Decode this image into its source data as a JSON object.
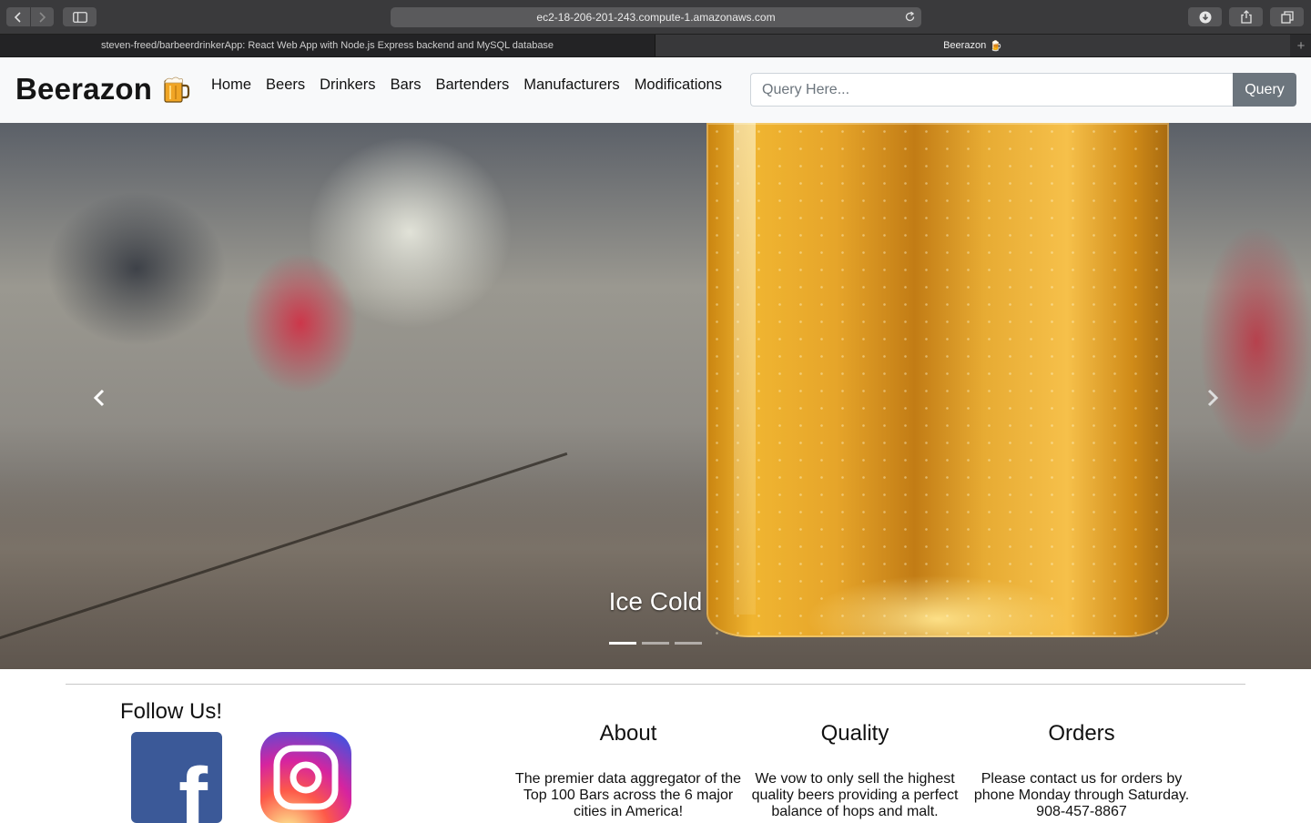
{
  "browser": {
    "url": "ec2-18-206-201-243.compute-1.amazonaws.com",
    "tabs": [
      {
        "title": "steven-freed/barbeerdrinkerApp: React Web App with Node.js Express backend and MySQL database"
      },
      {
        "title": "Beerazon"
      }
    ]
  },
  "navbar": {
    "brand": "Beerazon",
    "links": [
      "Home",
      "Beers",
      "Drinkers",
      "Bars",
      "Bartenders",
      "Manufacturers",
      "Modifications"
    ],
    "search_placeholder": "Query Here...",
    "query_button": "Query"
  },
  "carousel": {
    "caption": "Ice Cold",
    "slide_count": 3,
    "active_index": 0
  },
  "footer": {
    "follow_title": "Follow Us!",
    "social": [
      "facebook-icon",
      "instagram-icon"
    ],
    "columns": [
      {
        "title": "About",
        "text": "The premier data aggregator of the Top 100 Bars across the 6 major cities in America!"
      },
      {
        "title": "Quality",
        "text": "We vow to only sell the highest quality beers providing a perfect balance of hops and malt."
      },
      {
        "title": "Orders",
        "text": "Please contact us for orders by phone Monday through Saturday. 908-457-8867"
      }
    ]
  },
  "colors": {
    "navbar_bg": "#f8f9fa",
    "query_button_bg": "#6c757d",
    "facebook_blue": "#3b5998"
  }
}
